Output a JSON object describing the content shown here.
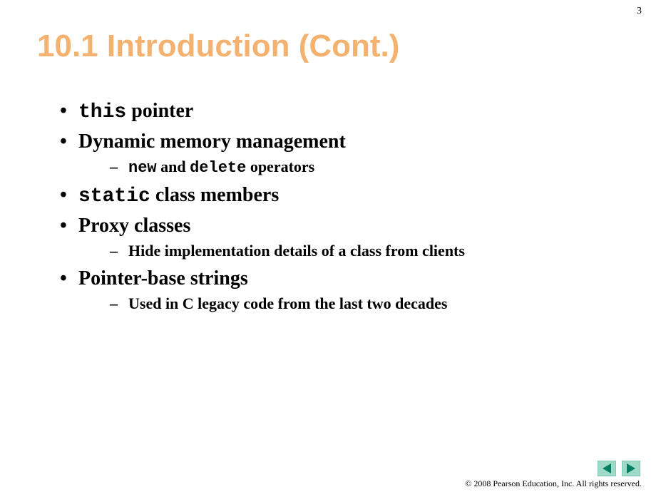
{
  "pageNumber": "3",
  "title": "10.1 Introduction (Cont.)",
  "bullets": {
    "b1_mono": "this",
    "b1_rest": " pointer",
    "b2": "Dynamic memory management",
    "b2_sub_mono1": "new",
    "b2_sub_mid": " and ",
    "b2_sub_mono2": "delete",
    "b2_sub_rest": " operators",
    "b3_mono": "static",
    "b3_rest": " class members",
    "b4": "Proxy classes",
    "b4_sub": "Hide implementation details of a class from clients",
    "b5": "Pointer-base strings",
    "b5_sub": "Used in C legacy code from the last two decades"
  },
  "copyright": "© 2008 Pearson Education, Inc.  All rights reserved.",
  "nav": {
    "prevColor": "#008060",
    "nextColor": "#008060"
  }
}
